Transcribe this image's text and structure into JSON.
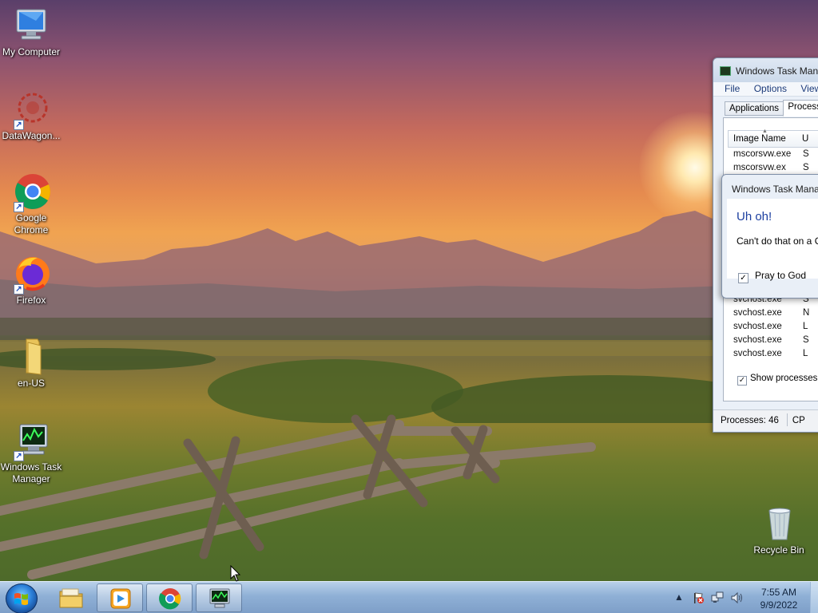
{
  "desktop": {
    "icons": [
      {
        "label": "My Computer",
        "icon": "computer-icon"
      },
      {
        "label": "DataWagon...",
        "icon": "datawagon-icon"
      },
      {
        "label": "Google Chrome",
        "icon": "chrome-icon"
      },
      {
        "label": "Firefox",
        "icon": "firefox-icon"
      },
      {
        "label": "en-US",
        "icon": "folder-icon"
      },
      {
        "label": "Windows Task Manager",
        "icon": "task-manager-icon"
      },
      {
        "label": "Recycle Bin",
        "icon": "recycle-bin-icon"
      }
    ]
  },
  "task_manager": {
    "title": "Windows Task Manager",
    "menu": [
      "File",
      "Options",
      "View"
    ],
    "tabs": [
      "Applications",
      "Processes"
    ],
    "active_tab": "Processes",
    "columns": [
      "Image Name",
      "U"
    ],
    "rows_top": [
      {
        "name": "mscorsvw.exe",
        "user": "S"
      },
      {
        "name": "mscorsvw.ex",
        "user": "S"
      }
    ],
    "rows_bottom": [
      {
        "name": "svchost.exe",
        "user": "S"
      },
      {
        "name": "svchost.exe",
        "user": "N"
      },
      {
        "name": "svchost.exe",
        "user": "L"
      },
      {
        "name": "svchost.exe",
        "user": "S"
      },
      {
        "name": "svchost.exe",
        "user": "L"
      }
    ],
    "show_all_label": "Show processes f",
    "show_all_checked": true,
    "status_processes": "Processes: 46",
    "status_cpu": "CP"
  },
  "dialog": {
    "title": "Windows Task Mana",
    "heading": "Uh oh!",
    "message": "Can't do that on a C",
    "checkbox_label": "Pray to God",
    "checkbox_checked": true
  },
  "taskbar": {
    "pinned": [
      {
        "name": "explorer",
        "icon": "folder-icon",
        "running": false
      },
      {
        "name": "media-player",
        "icon": "media-player-icon",
        "running": true
      },
      {
        "name": "chrome",
        "icon": "chrome-icon",
        "running": true
      },
      {
        "name": "task-manager",
        "icon": "task-manager-icon",
        "running": true
      }
    ],
    "clock_time": "7:55 AM",
    "clock_date": "9/9/2022"
  },
  "colors": {
    "accent_blue": "#1c3fa0",
    "taskbar": "#8fb0d6"
  }
}
